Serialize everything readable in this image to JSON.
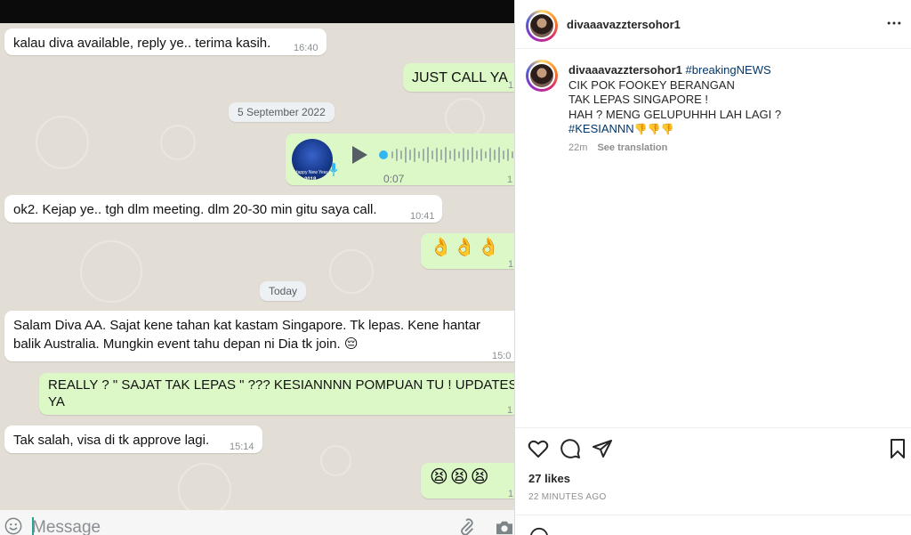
{
  "chat": {
    "messages": [
      {
        "text": "kalau diva available, reply ye.. terima kasih.",
        "time": "16:40"
      },
      {
        "text": "JUST CALL YA",
        "time": "1"
      },
      {
        "date": "5 September 2022"
      },
      {
        "voice_duration": "0:07",
        "time": "1",
        "thumb_text": "Happy New Year",
        "thumb_year": "2018"
      },
      {
        "text": "ok2. Kejap ye.. tgh dlm meeting. dlm 20-30 min gitu saya call.",
        "time": "10:41"
      },
      {
        "text": "👌👌👌",
        "time": "1"
      },
      {
        "date": "Today"
      },
      {
        "text_line1": "Salam Diva AA. Sajat kene tahan kat kastam Singapore. Tk lepas. Kene hantar",
        "text_line2": "balik Australia. Mungkin event tahu depan ni Dia tk join. 😔",
        "time": "15:0"
      },
      {
        "text_line1": "REALLY ? \" SAJAT TAK LEPAS \" ??? KESIANNNN POMPUAN TU ! UPDATES M",
        "text_line2": "YA",
        "time": "1"
      },
      {
        "text": "Tak salah, visa di tk approve lagi.",
        "time": "15:14"
      },
      {
        "text": "😫😫😫",
        "time": "1"
      }
    ],
    "composer_placeholder": "Message",
    "icons": [
      "emoji-icon",
      "attach-icon",
      "camera-icon",
      "mic-icon",
      "play-icon"
    ]
  },
  "instagram": {
    "username": "divaaavazztersohor1",
    "caption_user": "divaaavazztersohor1",
    "caption_tag_first": "#breakingNEWS",
    "caption_line2": "CIK POK FOOKEY BERANGAN",
    "caption_line3": "TAK LEPAS SINGAPORE !",
    "caption_line4": "HAH ? MENG GELUPUHHH LAH LAGI ?",
    "caption_tag_last": "#KESIANNN",
    "caption_emoji": "👎👎👎",
    "time_ago_short": "22m",
    "see_translation": "See translation",
    "likes": "27 likes",
    "time_ago_long": "22 MINUTES AGO",
    "icons": [
      "more-icon",
      "heart-icon",
      "comment-icon",
      "share-icon",
      "bookmark-icon"
    ]
  }
}
